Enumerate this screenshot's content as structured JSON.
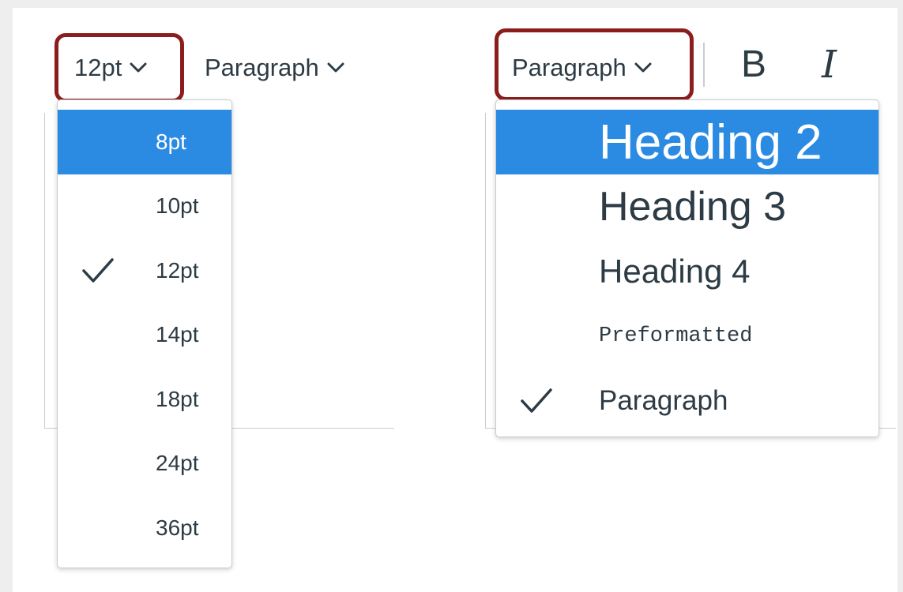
{
  "left_toolbar": {
    "font_size_button": "12pt",
    "block_format_button": "Paragraph"
  },
  "font_size_menu": {
    "items": [
      {
        "label": "8pt",
        "state": "highlighted"
      },
      {
        "label": "10pt",
        "state": "normal"
      },
      {
        "label": "12pt",
        "state": "checked"
      },
      {
        "label": "14pt",
        "state": "normal"
      },
      {
        "label": "18pt",
        "state": "normal"
      },
      {
        "label": "24pt",
        "state": "normal"
      },
      {
        "label": "36pt",
        "state": "normal"
      }
    ]
  },
  "right_toolbar": {
    "block_format_button": "Paragraph",
    "bold_label": "B",
    "italic_label": "I"
  },
  "block_format_menu": {
    "items": [
      {
        "label": "Heading 2",
        "state": "highlighted"
      },
      {
        "label": "Heading 3",
        "state": "normal"
      },
      {
        "label": "Heading 4",
        "state": "normal"
      },
      {
        "label": "Preformatted",
        "state": "normal"
      },
      {
        "label": "Paragraph",
        "state": "checked"
      }
    ]
  },
  "colors": {
    "highlight_ring": "#8c1d1d",
    "selected_item_bg": "#2b8ae2",
    "text": "#2d3b45",
    "border": "#c7cdd1"
  },
  "icons": {
    "dropdown": "chevron-down-icon",
    "selected": "checkmark-icon"
  }
}
